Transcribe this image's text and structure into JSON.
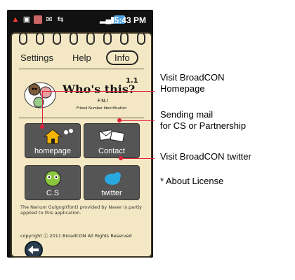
{
  "status_bar": {
    "time": "5:43 PM",
    "icons": [
      "warning-icon",
      "sim-icon",
      "avatar-icon",
      "mail-icon",
      "usb-icon",
      "signal-icon",
      "battery-icon"
    ]
  },
  "menu": {
    "settings": "Settings",
    "help": "Help",
    "info": "Info"
  },
  "logo": {
    "title": "Who's this?",
    "version": "1.1",
    "fni": "F.N.I",
    "subtitle": "Friend Number Identification"
  },
  "buttons": {
    "homepage": "homepage",
    "contact": "Contact",
    "cs": "C.S",
    "twitter": "twitter"
  },
  "credit": "The Nanum Gulgogi(font) provided by Naver is partly applied to this application.",
  "copyright": "copyright ⓒ 2011 BroadCON All Rights Reserved",
  "callouts": {
    "homepage": "Visit BroadCON Homepage",
    "mail_line1": "Sending mail",
    "mail_line2": "for CS or Partnership",
    "twitter": "Visit BroadCON twitter",
    "license": "* About License"
  },
  "colors": {
    "accent": "#e0203a",
    "paper": "#f4e8c4",
    "button": "#555555"
  }
}
